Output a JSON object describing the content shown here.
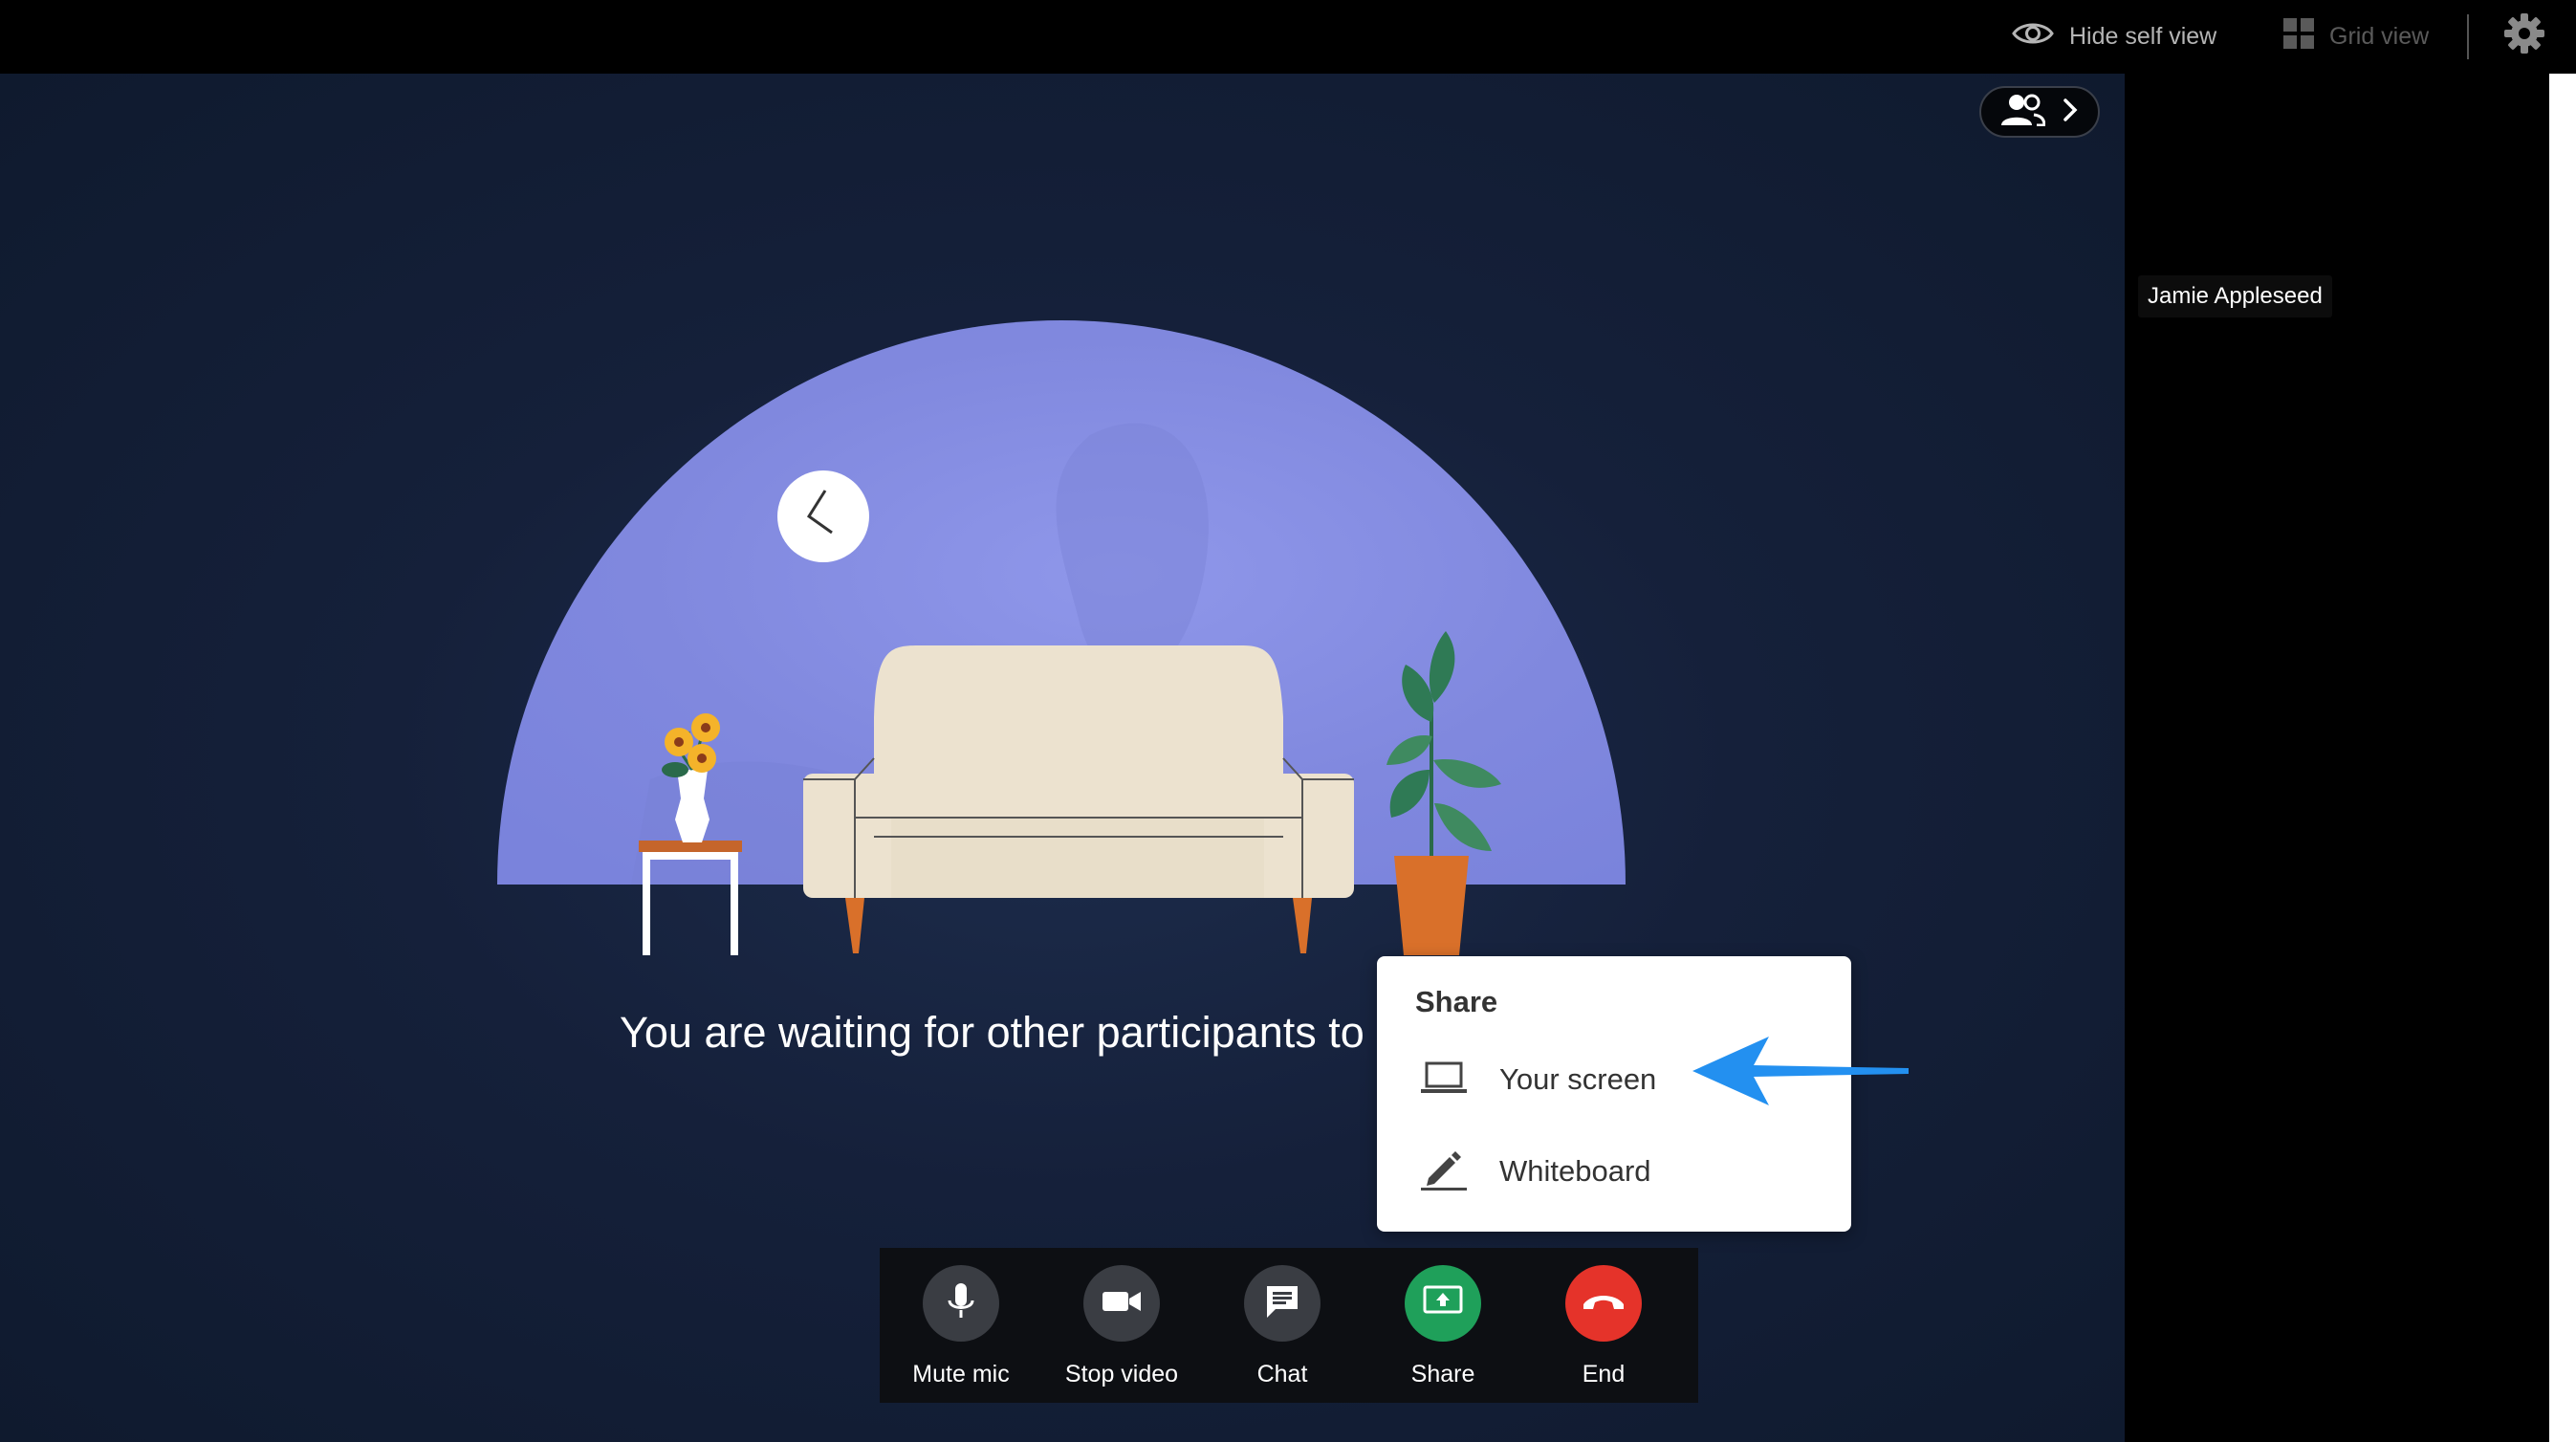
{
  "topbar": {
    "hide_self_view_label": "Hide self view",
    "grid_view_label": "Grid view"
  },
  "participants_panel": {
    "participant_name": "Jamie Appleseed"
  },
  "stage": {
    "waiting_message": "You are waiting for other participants to"
  },
  "share_menu": {
    "title": "Share",
    "items": [
      {
        "label": "Your screen",
        "icon": "laptop-icon"
      },
      {
        "label": "Whiteboard",
        "icon": "pencil-icon"
      }
    ]
  },
  "controls": [
    {
      "label": "Mute mic",
      "icon": "microphone-icon"
    },
    {
      "label": "Stop video",
      "icon": "video-camera-icon"
    },
    {
      "label": "Chat",
      "icon": "chat-icon"
    },
    {
      "label": "Share",
      "icon": "share-screen-icon"
    },
    {
      "label": "End",
      "icon": "hang-up-icon"
    }
  ],
  "colors": {
    "share_accent": "#1fa05a",
    "end_accent": "#e5332a",
    "annotation_arrow": "#2390f0",
    "illustration_sky": "#8c93e4"
  }
}
